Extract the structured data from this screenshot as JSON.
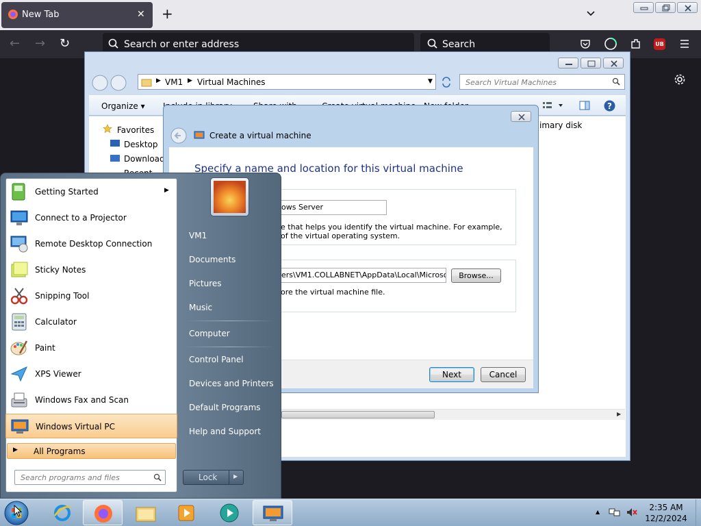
{
  "browser": {
    "tab_title": "New Tab",
    "url_placeholder": "Search or enter address",
    "search_placeholder": "Search",
    "extension_badge": "UB"
  },
  "explorer": {
    "breadcrumb": [
      "VM1",
      "Virtual Machines"
    ],
    "search_placeholder": "Search Virtual Machines",
    "toolbar": [
      "Organize",
      "Include in library",
      "Share with",
      "Create virtual machine",
      "New folder"
    ],
    "nav": {
      "favorites": "Favorites",
      "items": [
        "Desktop",
        "Downloads",
        "Recent Places"
      ]
    },
    "column_fragment": "imary disk"
  },
  "dialog": {
    "title": "Create a virtual machine",
    "heading": "Specify a name and location for this virtual machine",
    "name_value": "ows Server",
    "name_hint_line1": "e that helps you identify the virtual machine. For example,",
    "name_hint_line2": "of the virtual operating system.",
    "location_value": "ers\\VM1.COLLABNET\\AppData\\Local\\Microsoft\\",
    "browse_label": "Browse...",
    "location_hint": "ore the virtual machine file.",
    "next_label": "Next",
    "cancel_label": "Cancel"
  },
  "start_menu": {
    "programs": [
      {
        "label": "Getting Started",
        "icon": "getting-started-icon",
        "submenu": true
      },
      {
        "label": "Connect to a Projector",
        "icon": "projector-icon"
      },
      {
        "label": "Remote Desktop Connection",
        "icon": "remote-desktop-icon"
      },
      {
        "label": "Sticky Notes",
        "icon": "sticky-notes-icon"
      },
      {
        "label": "Snipping Tool",
        "icon": "snipping-tool-icon"
      },
      {
        "label": "Calculator",
        "icon": "calculator-icon"
      },
      {
        "label": "Paint",
        "icon": "paint-icon"
      },
      {
        "label": "XPS Viewer",
        "icon": "xps-viewer-icon"
      },
      {
        "label": "Windows Fax and Scan",
        "icon": "fax-scan-icon"
      },
      {
        "label": "Windows Virtual PC",
        "icon": "virtual-pc-icon",
        "highlighted": true
      }
    ],
    "all_programs": "All Programs",
    "search_placeholder": "Search programs and files",
    "right_links": [
      "VM1",
      "Documents",
      "Pictures",
      "Music",
      "Computer",
      "Control Panel",
      "Devices and Printers",
      "Default Programs",
      "Help and Support"
    ],
    "lock_label": "Lock"
  },
  "taskbar": {
    "time": "2:35 AM",
    "date": "12/2/2024"
  },
  "colors": {
    "ff_dark": "#1c1b22",
    "ff_toolbar": "#2b2a33",
    "aero_blue": "#cfdff1",
    "heading_blue": "#1e3287",
    "highlight_orange": "#f9cc8f"
  }
}
